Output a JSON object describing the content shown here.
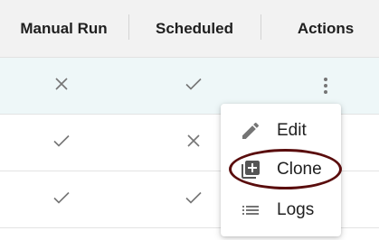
{
  "table": {
    "headers": {
      "manual_run": "Manual Run",
      "scheduled": "Scheduled",
      "actions": "Actions"
    },
    "rows": [
      {
        "manual_run": "no",
        "scheduled": "yes",
        "highlighted": true
      },
      {
        "manual_run": "yes",
        "scheduled": "no",
        "highlighted": false
      },
      {
        "manual_run": "yes",
        "scheduled": "yes",
        "highlighted": false
      }
    ]
  },
  "actions_menu": {
    "items": [
      {
        "label": "Edit",
        "icon": "pencil-icon"
      },
      {
        "label": "Clone",
        "icon": "clone-icon"
      },
      {
        "label": "Logs",
        "icon": "list-icon"
      }
    ],
    "annotated_item": "Clone"
  },
  "colors": {
    "icon_gray": "#757575",
    "header_bg": "#f2f2f2",
    "highlight_row_bg": "#eef7f8",
    "annotation_ring": "#5a0d0d"
  }
}
